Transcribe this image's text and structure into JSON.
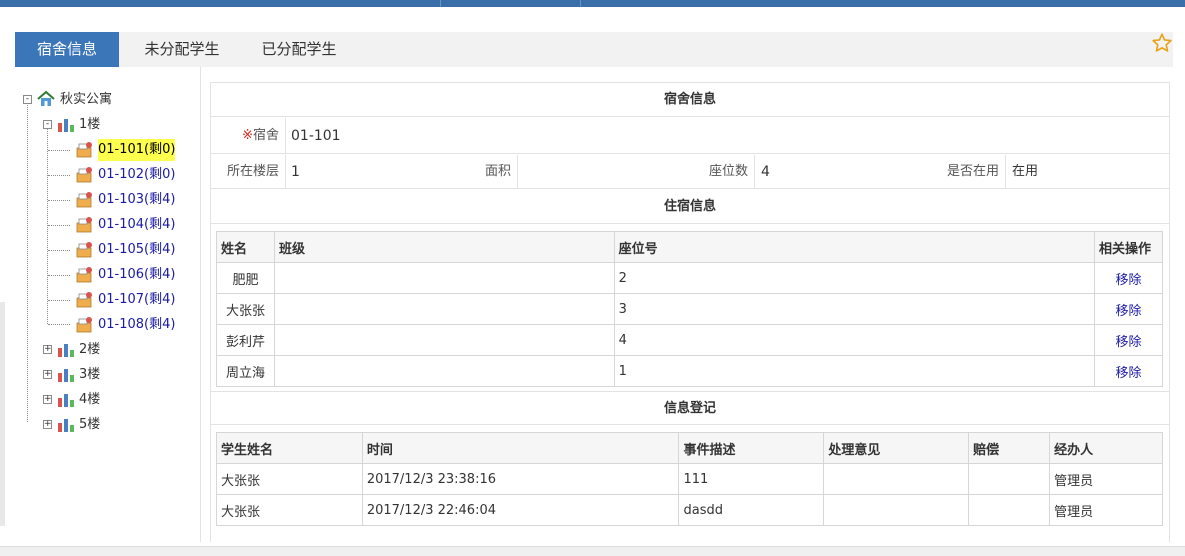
{
  "tabs": [
    {
      "label": "宿舍信息",
      "active": true
    },
    {
      "label": "未分配学生",
      "active": false
    },
    {
      "label": "已分配学生",
      "active": false
    }
  ],
  "tree": {
    "root": "秋实公寓",
    "floors": [
      "1楼",
      "2楼",
      "3楼",
      "4楼",
      "5楼"
    ],
    "rooms": [
      "01-101(剩0)",
      "01-102(剩0)",
      "01-103(剩4)",
      "01-104(剩4)",
      "01-105(剩4)",
      "01-106(剩4)",
      "01-107(剩4)",
      "01-108(剩4)"
    ],
    "selected_room": "01-101(剩0)"
  },
  "dorm": {
    "section_title": "宿舍信息",
    "room_label_mark": "※",
    "room_label": "宿舍",
    "room_value": "01-101",
    "floor_label": "所在楼层",
    "floor_value": "1",
    "area_label": "面积",
    "area_value": "",
    "seats_label": "座位数",
    "seats_value": "4",
    "inuse_label": "是否在用",
    "inuse_value": "在用"
  },
  "residents": {
    "section_title": "住宿信息",
    "headers": [
      "姓名",
      "班级",
      "座位号",
      "相关操作"
    ],
    "rows": [
      {
        "name": "肥肥",
        "class": "",
        "seat": "2",
        "action": "移除"
      },
      {
        "name": "大张张",
        "class": "",
        "seat": "3",
        "action": "移除"
      },
      {
        "name": "彭利芹",
        "class": "",
        "seat": "4",
        "action": "移除"
      },
      {
        "name": "周立海",
        "class": "",
        "seat": "1",
        "action": "移除"
      }
    ]
  },
  "records": {
    "section_title": "信息登记",
    "headers": [
      "学生姓名",
      "时间",
      "事件描述",
      "处理意见",
      "赔偿",
      "经办人"
    ],
    "rows": [
      {
        "student": "大张张",
        "time": "2017/12/3 23:38:16",
        "desc": "111",
        "opinion": "",
        "comp": "",
        "handler": "管理员"
      },
      {
        "student": "大张张",
        "time": "2017/12/3 22:46:04",
        "desc": "dasdd",
        "opinion": "",
        "comp": "",
        "handler": "管理员"
      }
    ]
  },
  "colors": {
    "accent": "#3b76b9",
    "selected_bg": "#ffff4d",
    "link": "#1a1aa6",
    "required": "#d9261c"
  },
  "icons": [
    "star-icon",
    "apartment-icon",
    "floor-icon",
    "room-icon"
  ]
}
